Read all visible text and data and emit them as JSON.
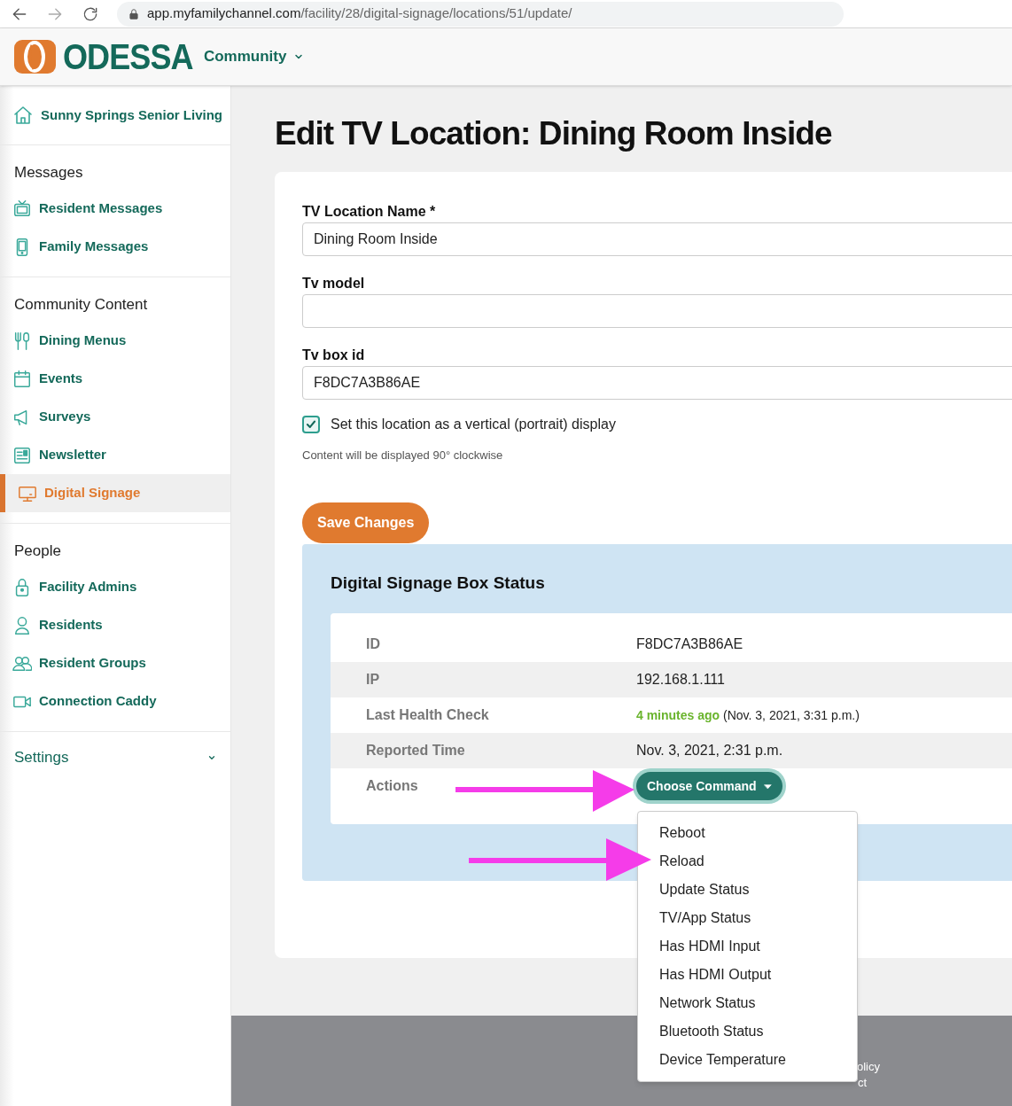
{
  "browser": {
    "url_host": "app.myfamilychannel.com",
    "url_path": "/facility/28/digital-signage/locations/51/update/"
  },
  "header": {
    "logo": "ODESSA",
    "nav": "Community"
  },
  "sidebar": {
    "facility": "Sunny Springs Senior Living",
    "sections": [
      {
        "title": "Messages",
        "items": [
          {
            "label": "Resident Messages",
            "selected": false
          },
          {
            "label": "Family Messages",
            "selected": false
          }
        ]
      },
      {
        "title": "Community Content",
        "items": [
          {
            "label": "Dining Menus",
            "selected": false
          },
          {
            "label": "Events",
            "selected": false
          },
          {
            "label": "Surveys",
            "selected": false
          },
          {
            "label": "Newsletter",
            "selected": false
          },
          {
            "label": "Digital Signage",
            "selected": true
          }
        ]
      },
      {
        "title": "People",
        "items": [
          {
            "label": "Facility Admins",
            "selected": false
          },
          {
            "label": "Residents",
            "selected": false
          },
          {
            "label": "Resident Groups",
            "selected": false
          },
          {
            "label": "Connection Caddy",
            "selected": false
          }
        ]
      }
    ],
    "settings": "Settings"
  },
  "page": {
    "title": "Edit TV Location: Dining Room Inside",
    "fields": [
      {
        "label": "TV Location Name *",
        "value": "Dining Room Inside"
      },
      {
        "label": "Tv model"
      },
      {
        "label": "Tv box id",
        "value": "F8DC7A3B86AE"
      }
    ],
    "checkbox": {
      "label": "Set this location as a vertical (portrait) display",
      "checked": true
    },
    "hint": "Content will be displayed 90° clockwise",
    "save": "Save Changes"
  },
  "status": {
    "title": "Digital Signage Box Status",
    "rows": [
      {
        "kind": "text",
        "label": "ID",
        "value": "F8DC7A3B86AE"
      },
      {
        "kind": "text",
        "label": "IP",
        "value": "192.168.1.111"
      },
      {
        "kind": "health",
        "label": "Last Health Check",
        "ago": "4 minutes ago",
        "value": "(Nov. 3, 2021, 3:31 p.m.)"
      },
      {
        "kind": "text",
        "label": "Reported Time",
        "value": "Nov. 3, 2021, 2:31 p.m."
      },
      {
        "kind": "actions",
        "label": "Actions",
        "button": "Choose Command",
        "expanded": true
      }
    ],
    "menu": [
      "Reboot",
      "Reload",
      "Update Status",
      "TV/App Status",
      "Has HDMI Input",
      "Has HDMI Output",
      "Network Status",
      "Bluetooth Status",
      "Device Temperature"
    ]
  },
  "footer": {
    "line_1": "olicy",
    "line_2": "ct"
  }
}
